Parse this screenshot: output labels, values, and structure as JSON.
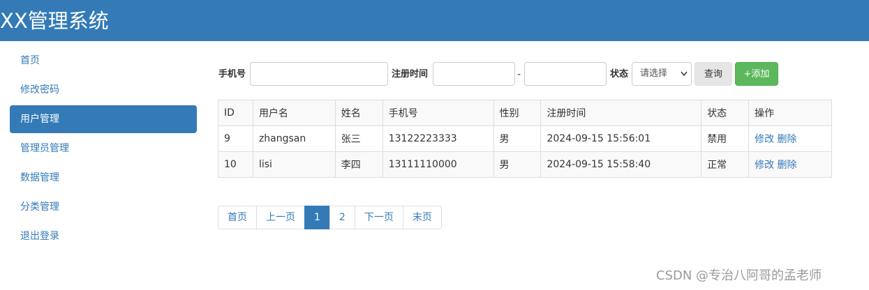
{
  "header": {
    "title": "XX管理系统"
  },
  "sidebar": {
    "items": [
      {
        "label": "首页"
      },
      {
        "label": "修改密码"
      },
      {
        "label": "用户管理"
      },
      {
        "label": "管理员管理"
      },
      {
        "label": "数据管理"
      },
      {
        "label": "分类管理"
      },
      {
        "label": "退出登录"
      }
    ],
    "active_index": 2
  },
  "search": {
    "phone_label": "手机号",
    "phone_value": "",
    "register_time_label": "注册时间",
    "date_start_value": "",
    "date_end_value": "",
    "date_separator": "-",
    "status_label": "状态",
    "status_selected": "请选择",
    "query_label": "查询",
    "add_label": "+添加"
  },
  "table": {
    "headers": [
      "ID",
      "用户名",
      "姓名",
      "手机号",
      "性别",
      "注册时间",
      "状态",
      "操作"
    ],
    "rows": [
      {
        "id": "9",
        "username": "zhangsan",
        "name": "张三",
        "phone": "13122223333",
        "gender": "男",
        "register_time": "2024-09-15 15:56:01",
        "status": "禁用"
      },
      {
        "id": "10",
        "username": "lisi",
        "name": "李四",
        "phone": "13111110000",
        "gender": "男",
        "register_time": "2024-09-15 15:58:40",
        "status": "正常"
      }
    ],
    "edit_label": "修改",
    "delete_label": "删除"
  },
  "pagination": {
    "first": "首页",
    "prev": "上一页",
    "pages": [
      "1",
      "2"
    ],
    "current": "1",
    "next": "下一页",
    "last": "末页"
  },
  "watermark": "CSDN @专治八阿哥的孟老师",
  "colors": {
    "primary": "#337ab7",
    "success": "#5cb85c",
    "border": "#dddddd"
  }
}
